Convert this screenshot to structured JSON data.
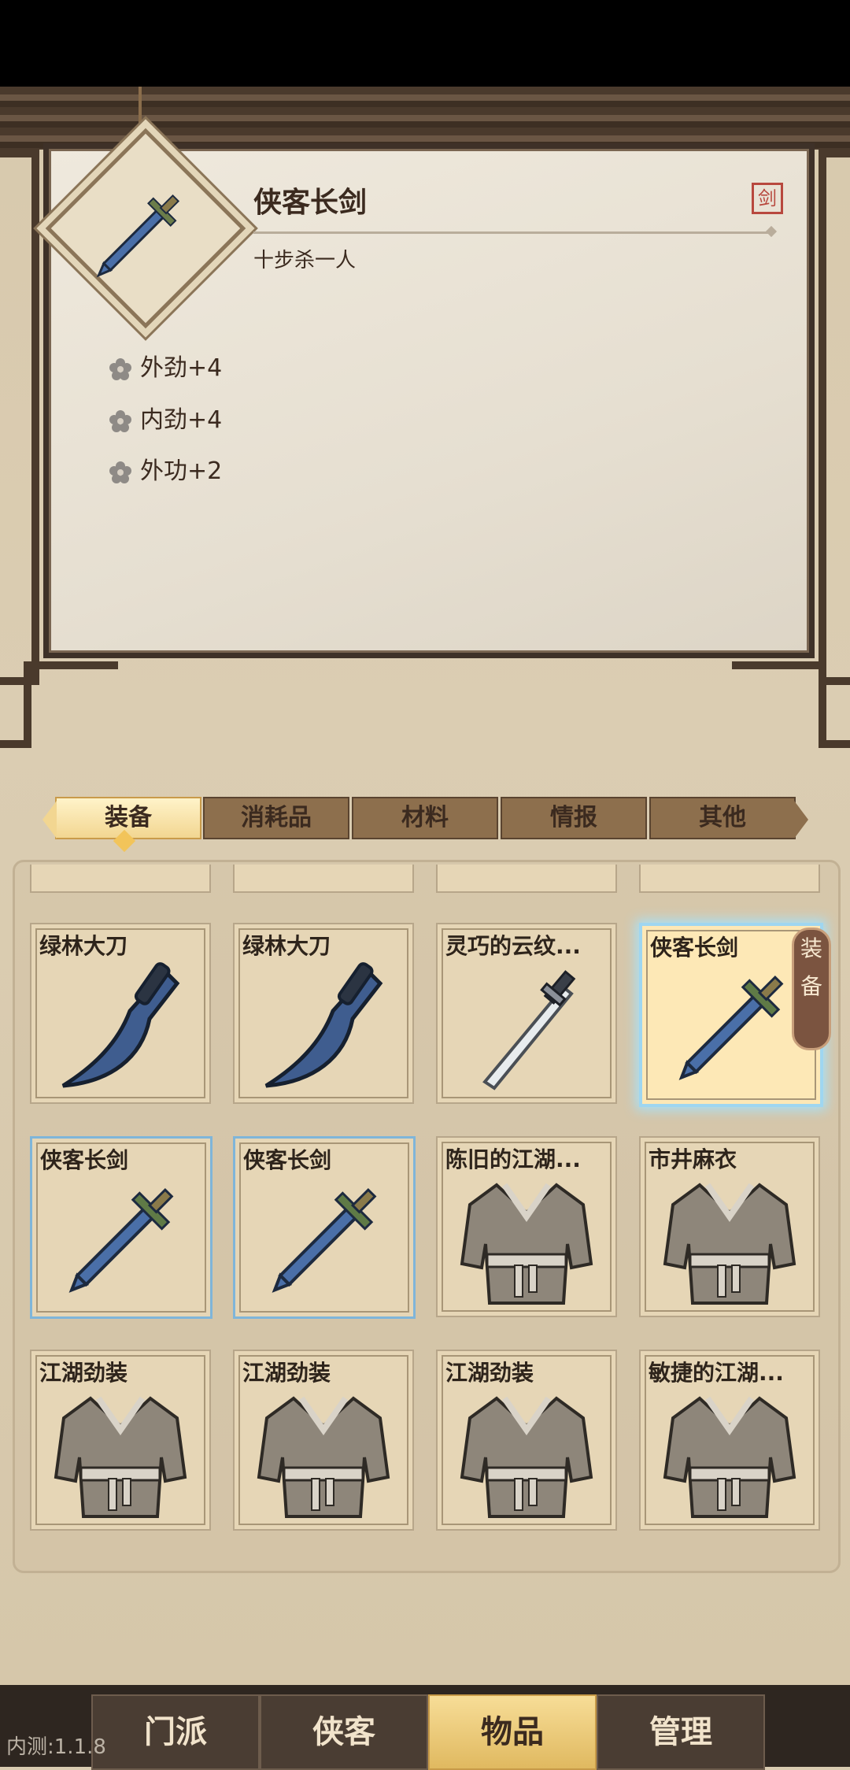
{
  "detail": {
    "name": "侠客长剑",
    "description": "十步杀一人",
    "type_badge": "剑",
    "stats": [
      {
        "label": "外劲+4"
      },
      {
        "label": "内劲+4"
      },
      {
        "label": "外功+2"
      }
    ]
  },
  "tabs": [
    {
      "label": "装备",
      "active": true
    },
    {
      "label": "消耗品",
      "active": false
    },
    {
      "label": "材料",
      "active": false
    },
    {
      "label": "情报",
      "active": false
    },
    {
      "label": "其他",
      "active": false
    }
  ],
  "items": [
    {
      "name": "绿林大刀",
      "icon": "saber-icon",
      "state": "normal"
    },
    {
      "name": "绿林大刀",
      "icon": "saber-icon",
      "state": "normal"
    },
    {
      "name": "灵巧的云纹...",
      "icon": "dao-sword-icon",
      "state": "normal"
    },
    {
      "name": "侠客长剑",
      "icon": "long-sword-icon",
      "state": "highlighted"
    },
    {
      "name": "侠客长剑",
      "icon": "long-sword-icon",
      "state": "selected"
    },
    {
      "name": "侠客长剑",
      "icon": "long-sword-icon",
      "state": "selected"
    },
    {
      "name": "陈旧的江湖...",
      "icon": "robe-icon",
      "state": "normal"
    },
    {
      "name": "市井麻衣",
      "icon": "robe-icon",
      "state": "normal"
    },
    {
      "name": "江湖劲装",
      "icon": "robe-icon",
      "state": "normal"
    },
    {
      "name": "江湖劲装",
      "icon": "robe-icon",
      "state": "normal"
    },
    {
      "name": "江湖劲装",
      "icon": "robe-icon",
      "state": "normal"
    },
    {
      "name": "敏捷的江湖...",
      "icon": "robe-icon",
      "state": "normal"
    }
  ],
  "equipped_tag": {
    "chars": [
      "装",
      "备"
    ]
  },
  "nav": [
    {
      "label": "门派",
      "active": false
    },
    {
      "label": "侠客",
      "active": false
    },
    {
      "label": "物品",
      "active": true
    },
    {
      "label": "管理",
      "active": false
    }
  ],
  "version": "内测:1.1.8",
  "colors": {
    "accent": "#f2d691",
    "panel_border": "#3e3128",
    "highlight": "#9fd6f0"
  }
}
